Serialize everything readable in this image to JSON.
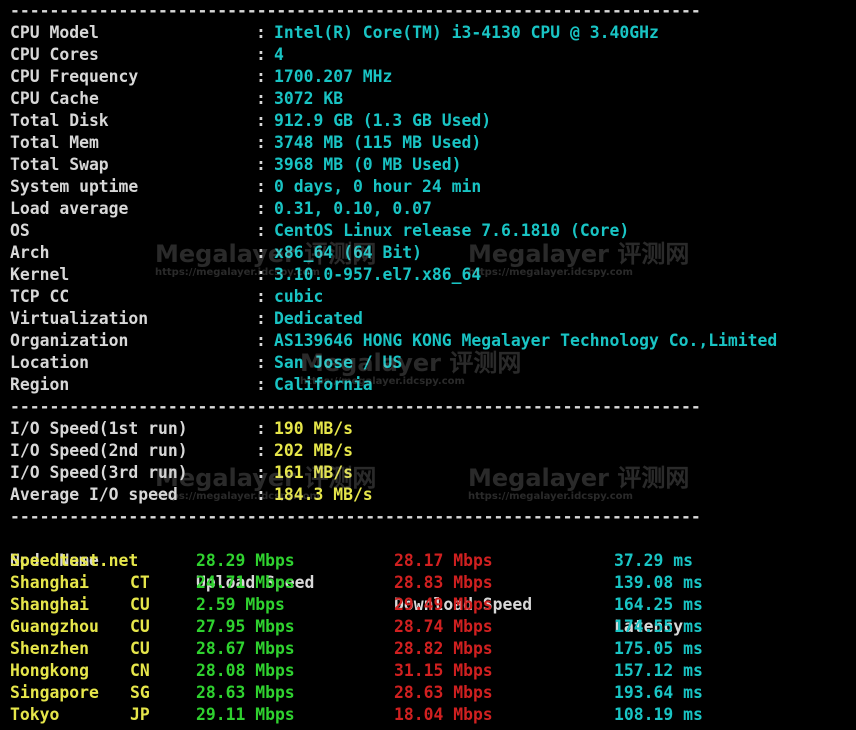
{
  "divider": "----------------------------------------------------------------------",
  "sep": ":",
  "sysinfo": [
    {
      "k": "CPU Model",
      "v": "Intel(R) Core(TM) i3-4130 CPU @ 3.40GHz"
    },
    {
      "k": "CPU Cores",
      "v": "4"
    },
    {
      "k": "CPU Frequency",
      "v": "1700.207 MHz"
    },
    {
      "k": "CPU Cache",
      "v": "3072 KB"
    },
    {
      "k": "Total Disk",
      "v": "912.9 GB (1.3 GB Used)"
    },
    {
      "k": "Total Mem",
      "v": "3748 MB (115 MB Used)"
    },
    {
      "k": "Total Swap",
      "v": "3968 MB (0 MB Used)"
    },
    {
      "k": "System uptime",
      "v": "0 days, 0 hour 24 min"
    },
    {
      "k": "Load average",
      "v": "0.31, 0.10, 0.07"
    },
    {
      "k": "OS",
      "v": "CentOS Linux release 7.6.1810 (Core)"
    },
    {
      "k": "Arch",
      "v": "x86_64 (64 Bit)"
    },
    {
      "k": "Kernel",
      "v": "3.10.0-957.el7.x86_64"
    },
    {
      "k": "TCP CC",
      "v": "cubic"
    },
    {
      "k": "Virtualization",
      "v": "Dedicated"
    },
    {
      "k": "Organization",
      "v": "AS139646 HONG KONG Megalayer Technology Co.,Limited"
    },
    {
      "k": "Location",
      "v": "San Jose / US"
    },
    {
      "k": "Region",
      "v": "California"
    }
  ],
  "io": [
    {
      "k": "I/O Speed(1st run)",
      "v": "190 MB/s"
    },
    {
      "k": "I/O Speed(2nd run)",
      "v": "202 MB/s"
    },
    {
      "k": "I/O Speed(3rd run)",
      "v": "161 MB/s"
    },
    {
      "k": "Average I/O speed",
      "v": "184.3 MB/s"
    }
  ],
  "speed_headers": {
    "node": "Node Name",
    "upload": "Upload Speed",
    "download": "Download Speed",
    "latency": "Latency"
  },
  "speed": [
    {
      "node": "Speedtest.net",
      "isp": "",
      "up": "28.29 Mbps",
      "down": "28.17 Mbps",
      "lat": "37.29 ms"
    },
    {
      "node": "Shanghai",
      "isp": "CT",
      "up": "24.71 Mbps",
      "down": "28.83 Mbps",
      "lat": "139.08 ms"
    },
    {
      "node": "Shanghai",
      "isp": "CU",
      "up": "2.59 Mbps",
      "down": "29.49 Mbps",
      "lat": "164.25 ms"
    },
    {
      "node": "Guangzhou",
      "isp": "CU",
      "up": "27.95 Mbps",
      "down": "28.74 Mbps",
      "lat": "174.55 ms"
    },
    {
      "node": "Shenzhen",
      "isp": "CU",
      "up": "28.67 Mbps",
      "down": "28.82 Mbps",
      "lat": "175.05 ms"
    },
    {
      "node": "Hongkong",
      "isp": "CN",
      "up": "28.08 Mbps",
      "down": "31.15 Mbps",
      "lat": "157.12 ms"
    },
    {
      "node": "Singapore",
      "isp": "SG",
      "up": "28.63 Mbps",
      "down": "28.63 Mbps",
      "lat": "193.64 ms"
    },
    {
      "node": "Tokyo",
      "isp": "JP",
      "up": "29.11 Mbps",
      "down": "18.04 Mbps",
      "lat": "108.19 ms"
    }
  ],
  "watermark": {
    "title": "Megalayer 评测网",
    "url": "https://megalayer.idcspy.com"
  },
  "colors": {
    "background": "#000000",
    "label": "#d8d8d8",
    "value": "#19c4c4",
    "io_value": "#e6e64a",
    "upload": "#2fd22f",
    "download": "#d02020"
  }
}
